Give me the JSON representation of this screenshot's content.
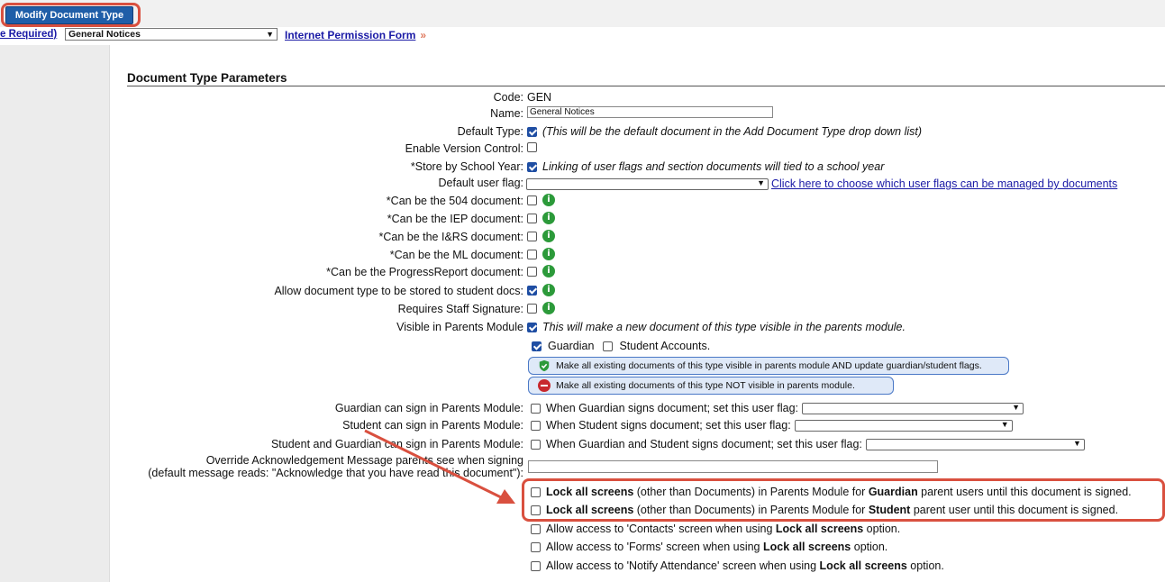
{
  "toolbar": {
    "modify_label": "Modify Document Type"
  },
  "crumbs": {
    "required_link": "e Required)",
    "document_select": "General Notices",
    "next_link": "Internet Permission Form",
    "next_arrow": "»"
  },
  "section": {
    "title": "Document Type Parameters"
  },
  "fields": {
    "code_label": "Code:",
    "code_value": "GEN",
    "name_label": "Name:",
    "name_value": "General Notices",
    "default_type_label": "Default Type:",
    "default_type_note": "(This will be the default document in the Add Document Type drop down list)",
    "version_label": "Enable Version Control:",
    "school_year_label": "*Store by School Year:",
    "school_year_note": "Linking of user flags and section documents will tied to a school year",
    "user_flag_label": "Default user flag:",
    "user_flag_link": "Click here to choose which user flags can be managed by documents",
    "doc_504_label": "*Can be the 504 document:",
    "doc_iep_label": "*Can be the IEP document:",
    "doc_irs_label": "*Can be the I&RS document:",
    "doc_ml_label": "*Can be the ML document:",
    "doc_progress_label": "*Can be the ProgressReport document:",
    "allow_student_docs_label": "Allow document type to be stored to student docs:",
    "staff_sig_label": "Requires Staff Signature:",
    "visible_parents_label": "Visible in Parents Module",
    "visible_parents_note": "This will make a new document of this type visible in the parents module.",
    "guardian_label": "Guardian",
    "student_accounts_label": "Student Accounts.",
    "make_visible_btn": "Make all existing documents of this type visible in parents module AND update guardian/student flags.",
    "make_not_visible_btn": "Make all existing documents of this type NOT visible in parents module.",
    "guardian_sign_label": "Guardian can sign in Parents Module:",
    "guardian_sign_note": "When Guardian signs document; set this user flag:",
    "student_sign_label": "Student can sign in Parents Module:",
    "student_sign_note": "When Student signs document; set this user flag:",
    "both_sign_label": "Student and Guardian can sign in Parents Module:",
    "both_sign_note": "When Guardian and Student signs document; set this user flag:",
    "override_label_1": "Override Acknowledgement Message parents see when signing",
    "override_label_2": "(default message reads: \"Acknowledge that you have read this document\"):"
  },
  "lock_options": {
    "lock_guardian": {
      "bold1": "Lock all screens",
      "text1": " (other than Documents) in Parents Module for ",
      "bold2": "Guardian",
      "text2": " parent users until this document is signed."
    },
    "lock_student": {
      "bold1": "Lock all screens",
      "text1": " (other than Documents) in Parents Module for ",
      "bold2": "Student",
      "text2": " parent user until this document is signed."
    },
    "contacts": {
      "text1": "Allow access to 'Contacts' screen when using ",
      "bold1": "Lock all screens",
      "text2": " option."
    },
    "forms": {
      "text1": "Allow access to 'Forms' screen when using ",
      "bold1": "Lock all screens",
      "text2": " option."
    },
    "attendance": {
      "text1": "Allow access to 'Notify Attendance' screen when using ",
      "bold1": "Lock all screens",
      "text2": " option."
    }
  },
  "colors": {
    "highlight": "#d9503f",
    "button": "#1f5ea8",
    "info": "#2c9a3a"
  }
}
